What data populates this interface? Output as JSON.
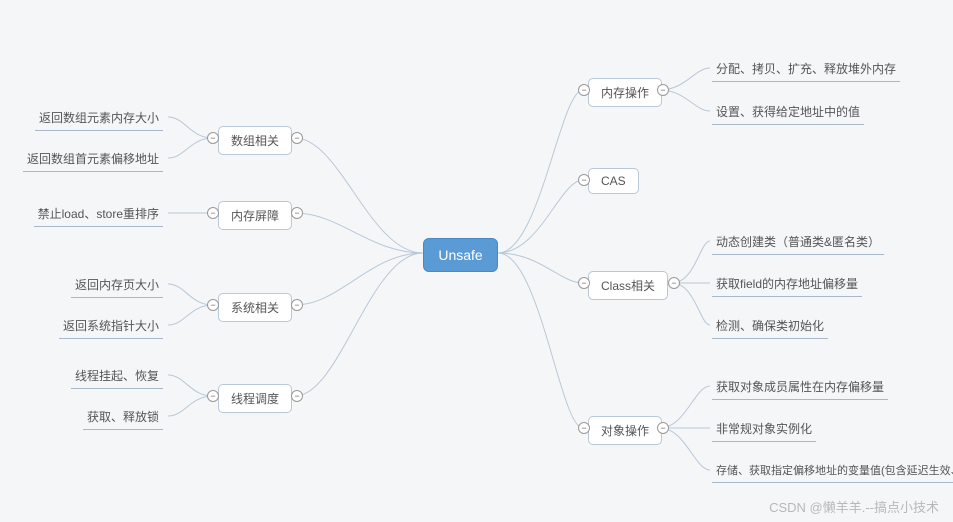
{
  "root": {
    "label": "Unsafe"
  },
  "left": {
    "array": {
      "label": "数组相关",
      "children": [
        {
          "label": "返回数组元素内存大小"
        },
        {
          "label": "返回数组首元素偏移地址"
        }
      ]
    },
    "barrier": {
      "label": "内存屏障",
      "children": [
        {
          "label": "禁止load、store重排序"
        }
      ]
    },
    "system": {
      "label": "系统相关",
      "children": [
        {
          "label": "返回内存页大小"
        },
        {
          "label": "返回系统指针大小"
        }
      ]
    },
    "thread": {
      "label": "线程调度",
      "children": [
        {
          "label": "线程挂起、恢复"
        },
        {
          "label": "获取、释放锁"
        }
      ]
    }
  },
  "right": {
    "memory": {
      "label": "内存操作",
      "children": [
        {
          "label": "分配、拷贝、扩充、释放堆外内存"
        },
        {
          "label": "设置、获得给定地址中的值"
        }
      ]
    },
    "cas": {
      "label": "CAS"
    },
    "class": {
      "label": "Class相关",
      "children": [
        {
          "label": "动态创建类（普通类&匿名类）"
        },
        {
          "label": "获取field的内存地址偏移量"
        },
        {
          "label": "检测、确保类初始化"
        }
      ]
    },
    "object": {
      "label": "对象操作",
      "children": [
        {
          "label": "获取对象成员属性在内存偏移量"
        },
        {
          "label": "非常规对象实例化"
        },
        {
          "label": "存储、获取指定偏移地址的变量值(包含延迟生效、volatile语义)"
        }
      ]
    }
  },
  "watermark": "CSDN @懒羊羊.--搞点小技术",
  "toggle_symbol": "−"
}
